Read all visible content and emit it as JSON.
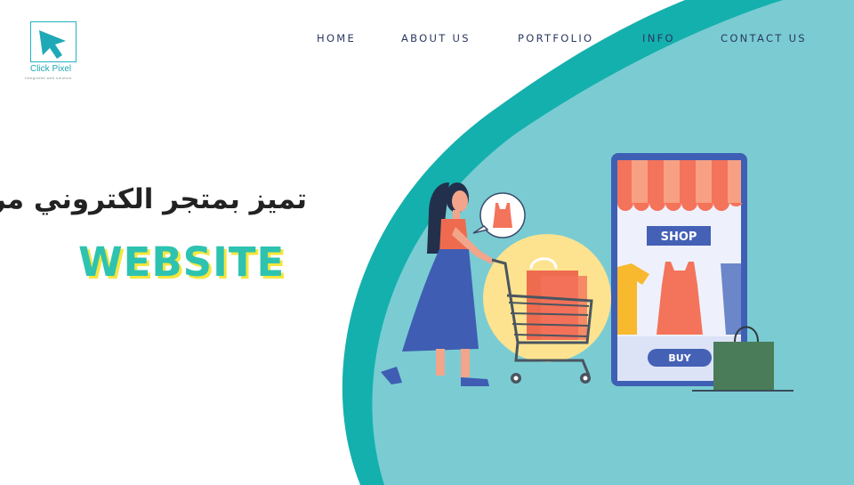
{
  "brand": {
    "name": "Click Pixel",
    "tagline": "Integrated web solution"
  },
  "nav": {
    "items": [
      "HOME",
      "ABOUT US",
      "PORTFOLIO",
      "INFO",
      "CONTACT US"
    ]
  },
  "hero": {
    "headline_ar": "تميز بمتجر الكتروني مرن",
    "headline_en": "WEBSITE"
  },
  "illustration": {
    "shop_sign": "SHOP",
    "buy_button": "BUY"
  },
  "colors": {
    "teal_light": "#7accd2",
    "teal_dark": "#14b0ad",
    "nav_text": "#2a3760",
    "accent_yellow": "#f5e63d",
    "phone_blue": "#3f5fb5"
  }
}
